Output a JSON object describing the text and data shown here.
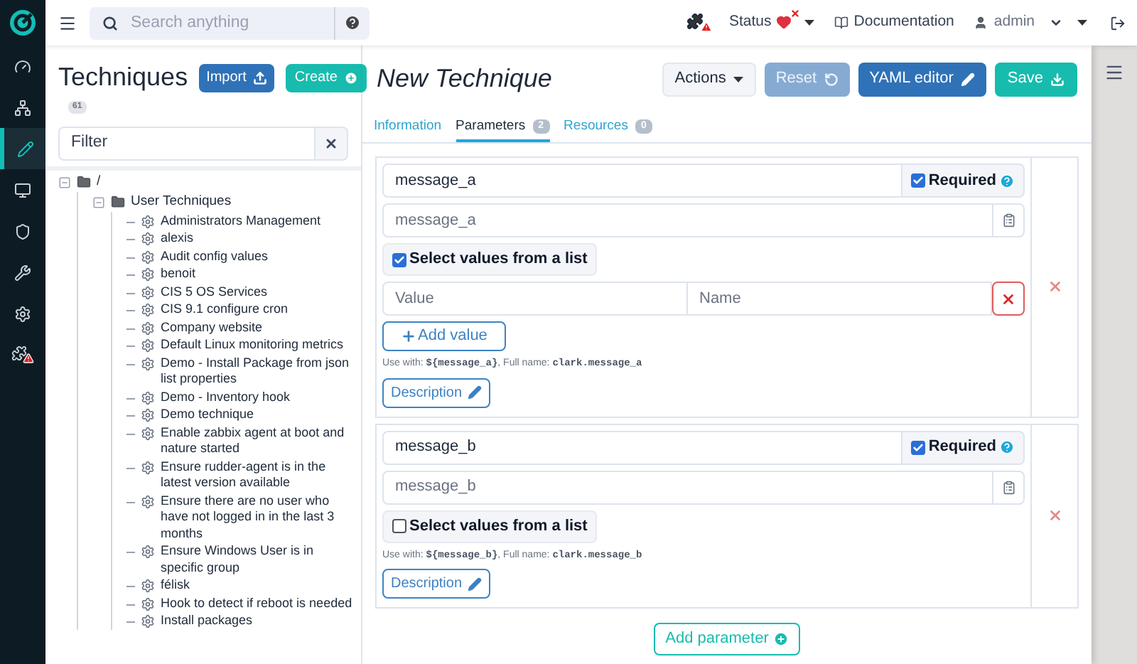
{
  "topbar": {
    "search": {
      "placeholder": "Search anything"
    },
    "status": "Status",
    "documentation": "Documentation",
    "user": "admin"
  },
  "techniques_panel": {
    "title": "Techniques",
    "import": "Import",
    "create": "Create",
    "count": "61",
    "filter": {
      "placeholder": "Filter"
    },
    "tree": [
      {
        "kind": "folder",
        "label": "/",
        "expanded": true,
        "children": [
          {
            "kind": "folder",
            "label": "User Techniques",
            "expanded": true,
            "children": [
              {
                "kind": "technique",
                "label": "Administrators Management"
              },
              {
                "kind": "technique",
                "label": "alexis"
              },
              {
                "kind": "technique",
                "label": "Audit config values"
              },
              {
                "kind": "technique",
                "label": "benoit"
              },
              {
                "kind": "technique",
                "label": "CIS 5 OS Services"
              },
              {
                "kind": "technique",
                "label": "CIS 9.1 configure cron"
              },
              {
                "kind": "technique",
                "label": "Company website"
              },
              {
                "kind": "technique",
                "label": "Default Linux monitoring metrics"
              },
              {
                "kind": "technique",
                "label": "Demo - Install Package from json list properties"
              },
              {
                "kind": "technique",
                "label": "Demo - Inventory hook"
              },
              {
                "kind": "technique",
                "label": "Demo technique"
              },
              {
                "kind": "technique",
                "label": "Enable zabbix agent at boot and nature started"
              },
              {
                "kind": "technique",
                "label": "Ensure rudder-agent is in the latest version available"
              },
              {
                "kind": "technique",
                "label": "Ensure there are no user who have not logged in in the last 3 months"
              },
              {
                "kind": "technique",
                "label": "Ensure Windows User is in specific group"
              },
              {
                "kind": "technique",
                "label": "félisk"
              },
              {
                "kind": "technique",
                "label": "Hook to detect if reboot is needed"
              },
              {
                "kind": "technique",
                "label": "Install packages"
              }
            ]
          }
        ]
      }
    ]
  },
  "editor": {
    "title": "New Technique",
    "actions": "Actions",
    "reset": "Reset",
    "yaml": "YAML editor",
    "save": "Save",
    "tabs": [
      {
        "label": "Information",
        "selected": false
      },
      {
        "label": "Parameters",
        "count": "2",
        "selected": true
      },
      {
        "label": "Resources",
        "count": "0",
        "selected": false
      }
    ],
    "parameters": [
      {
        "name": "message_a",
        "required_label": "Required",
        "required": true,
        "description_placeholder": "message_a",
        "list_label": "Select values from a list",
        "list": true,
        "value_placeholder": "Value",
        "name_placeholder": "Name",
        "add_value": "Add value",
        "use_with_label": "Use with:",
        "variable": "${message_a}",
        "full_name_label": ", Full name:",
        "full_name": "clark.message_a",
        "description": "Description"
      },
      {
        "name": "message_b",
        "required_label": "Required",
        "required": true,
        "description_placeholder": "message_b",
        "list_label": "Select values from a list",
        "list": false,
        "use_with_label": "Use with:",
        "variable": "${message_b}",
        "full_name_label": ", Full name:",
        "full_name": "clark.message_b",
        "description": "Description"
      }
    ],
    "add_parameter": "Add parameter"
  }
}
